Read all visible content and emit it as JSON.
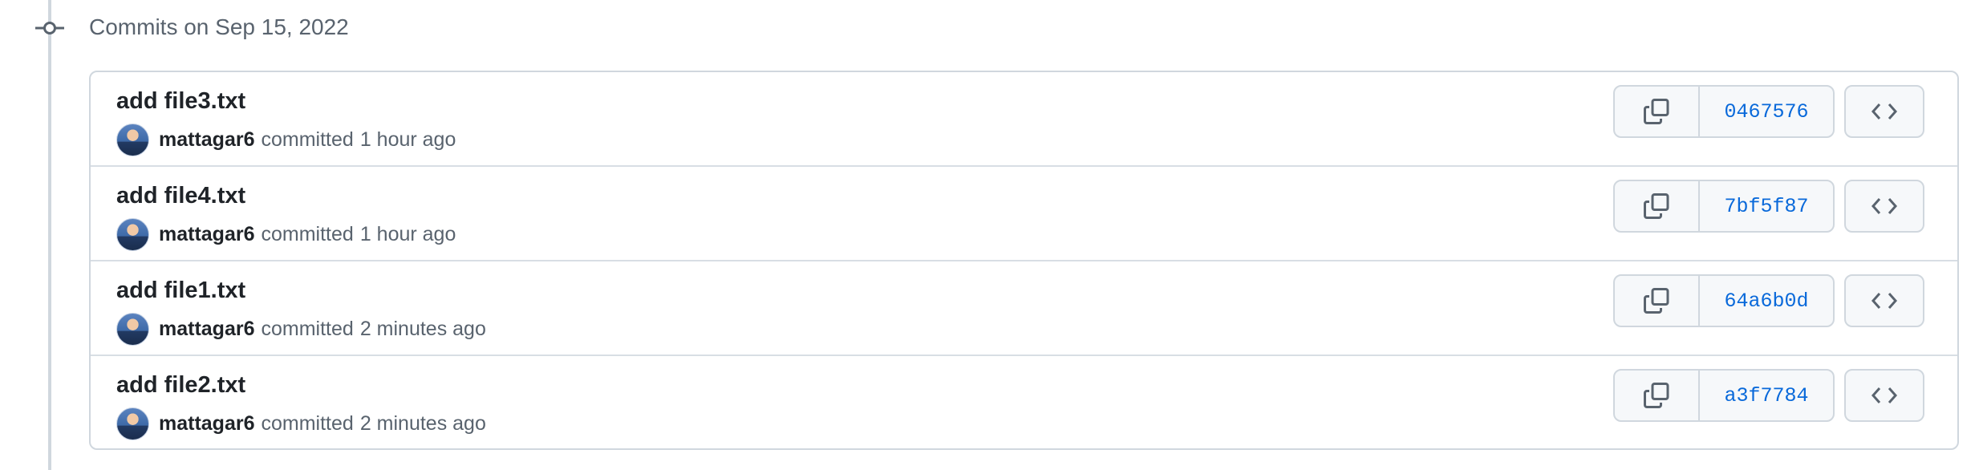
{
  "group": {
    "title": "Commits on Sep 15, 2022"
  },
  "commits": [
    {
      "message": "add file3.txt",
      "author": "mattagar6",
      "action": "committed",
      "time": "1 hour ago",
      "sha": "0467576"
    },
    {
      "message": "add file4.txt",
      "author": "mattagar6",
      "action": "committed",
      "time": "1 hour ago",
      "sha": "7bf5f87"
    },
    {
      "message": "add file1.txt",
      "author": "mattagar6",
      "action": "committed",
      "time": "2 minutes ago",
      "sha": "64a6b0d"
    },
    {
      "message": "add file2.txt",
      "author": "mattagar6",
      "action": "committed",
      "time": "2 minutes ago",
      "sha": "a3f7784"
    }
  ],
  "icons": {
    "timeline": "git-commit-icon",
    "copy": "copy-icon",
    "browse": "code-icon"
  },
  "colors": {
    "link": "#0969da",
    "muted": "#59636e",
    "border": "#d0d7de"
  }
}
